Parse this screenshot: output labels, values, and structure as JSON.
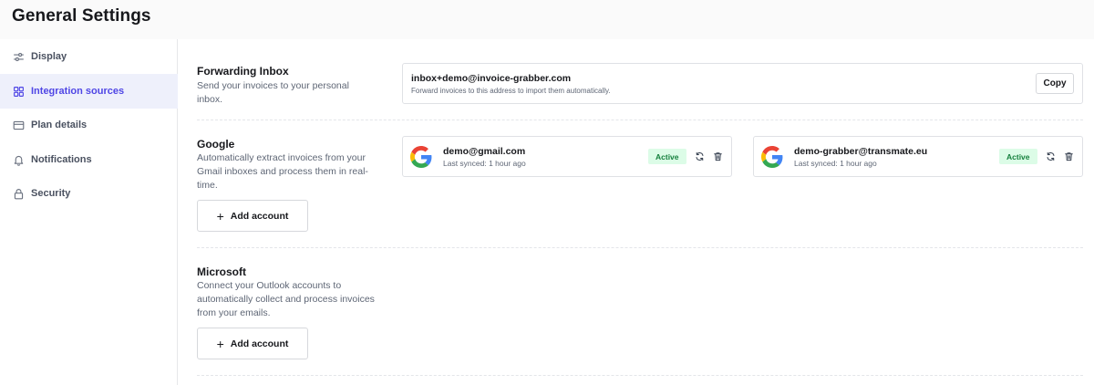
{
  "header": {
    "title": "General Settings"
  },
  "sidebar": {
    "items": [
      {
        "label": "Display",
        "icon": "sliders-icon",
        "active": false
      },
      {
        "label": "Integration sources",
        "icon": "grid-icon",
        "active": true
      },
      {
        "label": "Plan details",
        "icon": "credit-card-icon",
        "active": false
      },
      {
        "label": "Notifications",
        "icon": "bell-icon",
        "active": false
      },
      {
        "label": "Security",
        "icon": "lock-icon",
        "active": false
      }
    ]
  },
  "forwarding": {
    "title": "Forwarding Inbox",
    "description": "Send your invoices to your personal inbox.",
    "email": "inbox+demo@invoice-grabber.com",
    "hint": "Forward invoices to this address to import them automatically.",
    "copy_label": "Copy"
  },
  "google": {
    "title": "Google",
    "description": "Automatically extract invoices from your Gmail inboxes and process them in real-time.",
    "add_label": "Add account",
    "accounts": [
      {
        "email": "demo@gmail.com",
        "sync": "Last synced: 1 hour ago",
        "status": "Active"
      },
      {
        "email": "demo-grabber@transmate.eu",
        "sync": "Last synced: 1 hour ago",
        "status": "Active"
      }
    ]
  },
  "microsoft": {
    "title": "Microsoft",
    "description": "Connect your Outlook accounts to automatically collect and process invoices from your emails.",
    "add_label": "Add account"
  },
  "colors": {
    "accent": "#4f46e5",
    "active_bg": "#dcfce7",
    "active_text": "#15803d"
  }
}
